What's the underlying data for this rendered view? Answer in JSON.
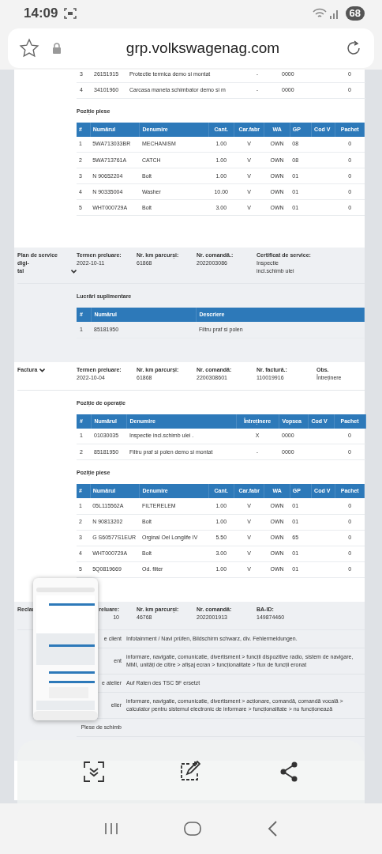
{
  "status_bar": {
    "time": "14:09",
    "battery": "68"
  },
  "address_bar": {
    "url": "grp.volkswagenag.com"
  },
  "sections": [
    {
      "subsections": [
        {
          "table": {
            "kind": "operations",
            "rows": [
              [
                "3",
                "26151915",
                "Protectie termica demo si montat",
                "-",
                "0000",
                null,
                "0"
              ],
              [
                "4",
                "34101960",
                "Carcasa maneta schimbator demo si m",
                "-",
                "0000",
                null,
                "0"
              ]
            ]
          }
        },
        {
          "title": "Poziție piese",
          "table": {
            "kind": "parts",
            "columns": [
              "#",
              "Numărul",
              "Denumire",
              "Cant.",
              "Car.fabr",
              "WA",
              "GP",
              "Cod V",
              "Pachet"
            ],
            "rows": [
              [
                "1",
                "5WA713033BR",
                "MECHANISM",
                "1.00",
                "V",
                "OWN",
                "08",
                null,
                "0"
              ],
              [
                "2",
                "5WA713761A",
                "CATCH",
                "1.00",
                "V",
                "OWN",
                "08",
                null,
                "0"
              ],
              [
                "3",
                "N 90652204",
                "Bolt",
                "1.00",
                "V",
                "OWN",
                "01",
                null,
                "0"
              ],
              [
                "4",
                "N 90335004",
                "Washer",
                "10.00",
                "V",
                "OWN",
                "01",
                null,
                "0"
              ],
              [
                "5",
                "WHT000729A",
                "Bolt",
                "3.00",
                "V",
                "OWN",
                "01",
                null,
                "0"
              ]
            ]
          }
        }
      ]
    },
    {
      "label": "Plan de service digi-\ntal",
      "expanded": true,
      "fields": [
        {
          "label": "Termen preluare:",
          "value": "2022-10-11"
        },
        {
          "label": "Nr. km parcurși:",
          "value": "61868"
        },
        {
          "label": "Nr. comandă.:",
          "value": "2022003086"
        },
        {
          "label": "Certificat de service:",
          "value": "Inspectie\nincl.schimb ulei"
        }
      ],
      "subsections": [
        {
          "title": "Lucrări suplimentare",
          "table": {
            "kind": "extra_work",
            "columns": [
              "#",
              "Numărul",
              "Descriere"
            ],
            "rows": [
              [
                "1",
                "85181950",
                "Filtru praf si polen"
              ]
            ]
          }
        }
      ]
    },
    {
      "label": "Factura",
      "expanded": true,
      "fields": [
        {
          "label": "Termen preluare:",
          "value": "2022-10-04"
        },
        {
          "label": "Nr. km parcurși:",
          "value": "61868"
        },
        {
          "label": "Nr. comandă:",
          "value": "2200308601"
        },
        {
          "label": "Nr. factură.:",
          "value": "110019916"
        },
        {
          "label": "Obs.",
          "value": "Întreținere"
        }
      ],
      "subsections": [
        {
          "title": "Poziție de operație",
          "table": {
            "kind": "operations",
            "columns": [
              "#",
              "Numărul",
              "Denumire",
              "Întreținere",
              "Vopsea",
              "Cod V",
              "Pachet"
            ],
            "rows": [
              [
                "1",
                "01030035",
                "Inspectie incl.schimb ulei .",
                "X",
                "0000",
                null,
                "0"
              ],
              [
                "2",
                "85181950",
                "Filtru praf si polen demo si montat",
                "-",
                "0000",
                null,
                "0"
              ]
            ]
          }
        },
        {
          "title": "Poziție piese",
          "table": {
            "kind": "parts",
            "columns": [
              "#",
              "Numărul",
              "Denumire",
              "Cant.",
              "Car.fabr",
              "WA",
              "GP",
              "Cod V",
              "Pachet"
            ],
            "rows": [
              [
                "1",
                "05L115562A",
                "FILTERELEM",
                "1.00",
                "V",
                "OWN",
                "01",
                null,
                "0"
              ],
              [
                "2",
                "N 90813202",
                "Bolt",
                "1.00",
                "V",
                "OWN",
                "01",
                null,
                "0"
              ],
              [
                "3",
                "G S60577S1EUR",
                "Orginal Oel Longlife IV",
                "5.50",
                "V",
                "OWN",
                "65",
                null,
                "0"
              ],
              [
                "4",
                "WHT000729A",
                "Bolt",
                "3.00",
                "V",
                "OWN",
                "01",
                null,
                "0"
              ],
              [
                "5",
                "5Q0819669",
                "Od. filter",
                "1.00",
                "V",
                "OWN",
                "01",
                null,
                "0"
              ]
            ]
          }
        }
      ]
    },
    {
      "label": "Reclar",
      "overlay": {
        "kind": "screenshot_thumbnail"
      },
      "fields": [
        {
          "label": "reluare:",
          "value": "10"
        },
        {
          "label": "Nr. km parcurși:",
          "value": "46768"
        },
        {
          "label": "Nr. comandă:",
          "value": "2022001913"
        },
        {
          "label": "BA-ID:",
          "value": "149874460"
        }
      ],
      "details": [
        {
          "label": "e client",
          "value": "Infotainment / Navi prüfen, Bildschirm schwarz, div. Fehlermeldungen."
        },
        {
          "label": "ent",
          "value": "informare, navigatie, comunicatie, divertisment > funcții dispozitive radio, sistem de navigare, MMI, unități de citire > afișaj ecran > funcționalitate > flux de funcții eronat"
        },
        {
          "label": "e atelier",
          "value": "Auf Raten des TSC 5F ersetzt"
        },
        {
          "label": "elier",
          "value": "informare, navigatie, comunicatie, divertisment > acționare, comandă, comandă vocală > calculator pentru sistemul electronic de informare > funcționalitate > nu funcționează"
        },
        {
          "label": "Piese de schimb"
        }
      ]
    }
  ]
}
